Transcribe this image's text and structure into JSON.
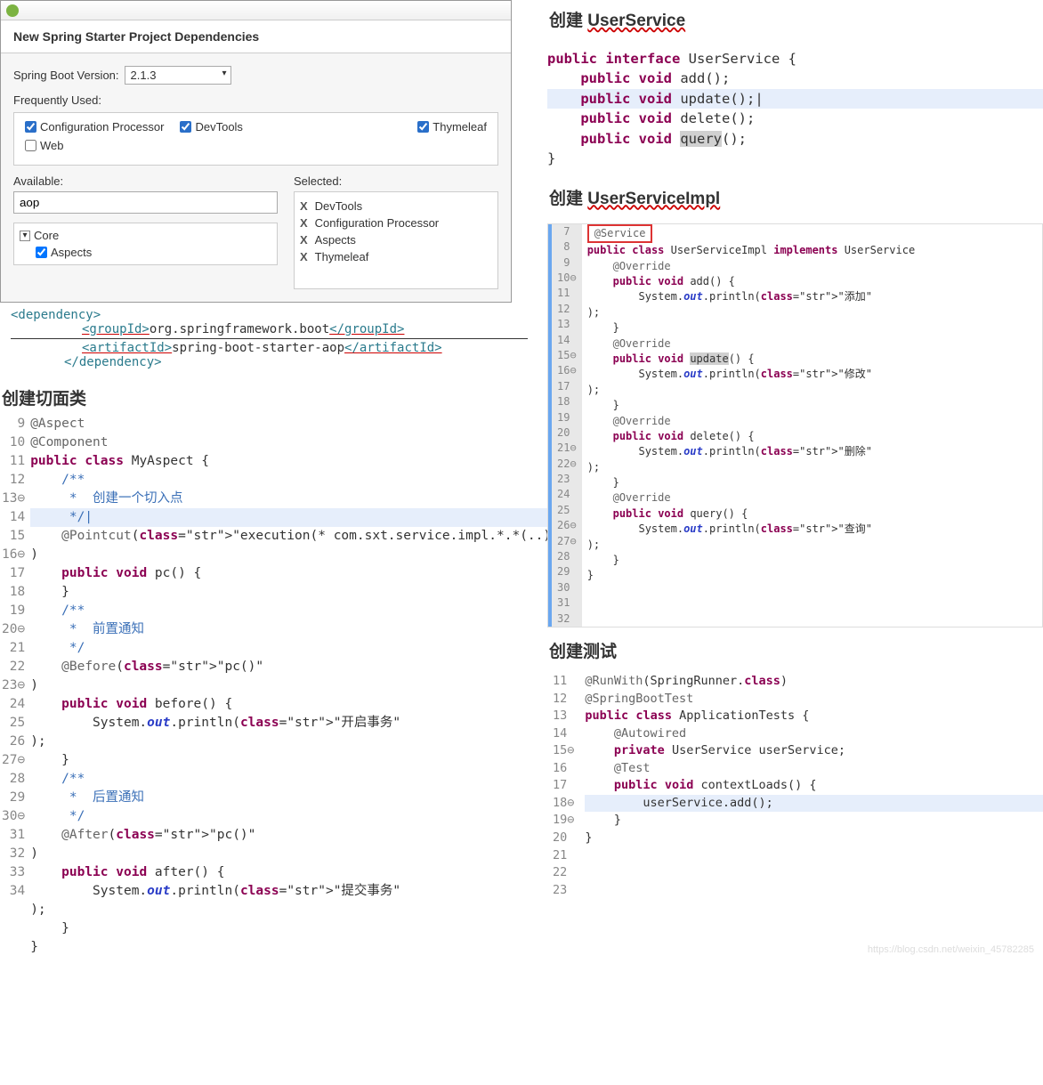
{
  "dialog": {
    "header": "New Spring Starter Project Dependencies",
    "bootVersionLabel": "Spring Boot Version:",
    "bootVersion": "2.1.3",
    "freqLabel": "Frequently Used:",
    "checks": [
      {
        "label": "Configuration Processor",
        "checked": true
      },
      {
        "label": "DevTools",
        "checked": true
      },
      {
        "label": "Thymeleaf",
        "checked": true
      },
      {
        "label": "Web",
        "checked": false
      }
    ],
    "availableLabel": "Available:",
    "availableValue": "aop",
    "treeParent": "Core",
    "treeChild": {
      "label": "Aspects",
      "checked": true
    },
    "selectedLabel": "Selected:",
    "selectedItems": [
      "DevTools",
      "Configuration Processor",
      "Aspects",
      "Thymeleaf"
    ]
  },
  "xml": {
    "openDep": "<dependency>",
    "groupOpen": "<groupId>",
    "groupText": "org.springframework.boot",
    "groupClose": "</groupId>",
    "artOpen": "<artifactId>",
    "artText": "spring-boot-starter-aop",
    "artClose": "</artifactId>",
    "closeDep": "</dependency>"
  },
  "leftTitle": "创建切面类",
  "aspectCode": {
    "lines": [
      {
        "n": "9",
        "m": " ",
        "t": "@Aspect"
      },
      {
        "n": "10",
        "m": " ",
        "t": "@Component"
      },
      {
        "n": "11",
        "m": " ",
        "t": "public class MyAspect {"
      },
      {
        "n": "12",
        "m": " ",
        "t": ""
      },
      {
        "n": "13",
        "m": "⊖",
        "t": "    /**"
      },
      {
        "n": "14",
        "m": " ",
        "t": "     *  创建一个切入点"
      },
      {
        "n": "15",
        "m": " ",
        "t": "     */|"
      },
      {
        "n": "16",
        "m": "⊖",
        "t": "    @Pointcut(\"execution(* com.sxt.service.impl.*.*(..))\")"
      },
      {
        "n": "17",
        "m": " ",
        "t": "    public void pc() {"
      },
      {
        "n": "18",
        "m": " ",
        "t": "    }"
      },
      {
        "n": "19",
        "m": " ",
        "t": ""
      },
      {
        "n": "20",
        "m": "⊖",
        "t": "    /**"
      },
      {
        "n": "21",
        "m": " ",
        "t": "     *  前置通知"
      },
      {
        "n": "22",
        "m": " ",
        "t": "     */"
      },
      {
        "n": "23",
        "m": "⊖",
        "t": "    @Before(\"pc()\")"
      },
      {
        "n": "24",
        "m": " ",
        "t": "    public void before() {"
      },
      {
        "n": "25",
        "m": " ",
        "t": "        System.out.println(\"开启事务\");"
      },
      {
        "n": "26",
        "m": " ",
        "t": "    }"
      },
      {
        "n": "27",
        "m": "⊖",
        "t": "    /**"
      },
      {
        "n": "28",
        "m": " ",
        "t": "     *  后置通知"
      },
      {
        "n": "29",
        "m": " ",
        "t": "     */"
      },
      {
        "n": "30",
        "m": "⊖",
        "t": "    @After(\"pc()\")"
      },
      {
        "n": "31",
        "m": " ",
        "t": "    public void after() {"
      },
      {
        "n": "32",
        "m": " ",
        "t": "        System.out.println(\"提交事务\");"
      },
      {
        "n": "33",
        "m": " ",
        "t": "    }"
      },
      {
        "n": "34",
        "m": " ",
        "t": "}"
      }
    ]
  },
  "right": {
    "title1": "创建 UserService",
    "ifaceCode": [
      "public interface UserService {",
      "",
      "    public void add();",
      "    public void update();|",
      "    public void delete();",
      "    public void query();",
      "}"
    ],
    "title2": "创建 UserServiceImpl",
    "implLines": [
      {
        "n": "7",
        "t": "@Service"
      },
      {
        "n": "8",
        "t": "public class UserServiceImpl implements UserService"
      },
      {
        "n": "9",
        "t": ""
      },
      {
        "n": "10",
        "t": "    @Override"
      },
      {
        "n": "11",
        "t": "    public void add() {"
      },
      {
        "n": "12",
        "t": "        System.out.println(\"添加\");"
      },
      {
        "n": "13",
        "t": "    }"
      },
      {
        "n": "14",
        "t": ""
      },
      {
        "n": "15",
        "t": "    @Override"
      },
      {
        "n": "16",
        "t": "    public void update() {"
      },
      {
        "n": "17",
        "t": "        System.out.println(\"修改\");"
      },
      {
        "n": "18",
        "t": ""
      },
      {
        "n": "19",
        "t": "    }"
      },
      {
        "n": "20",
        "t": ""
      },
      {
        "n": "21",
        "t": "    @Override"
      },
      {
        "n": "22",
        "t": "    public void delete() {"
      },
      {
        "n": "23",
        "t": "        System.out.println(\"删除\");"
      },
      {
        "n": "24",
        "t": ""
      },
      {
        "n": "25",
        "t": "    }"
      },
      {
        "n": "26",
        "t": "    @Override"
      },
      {
        "n": "27",
        "t": "    public void query() {"
      },
      {
        "n": "28",
        "t": "        System.out.println(\"查询\");"
      },
      {
        "n": "29",
        "t": ""
      },
      {
        "n": "30",
        "t": "    }"
      },
      {
        "n": "31",
        "t": "}"
      },
      {
        "n": "32",
        "t": ""
      }
    ],
    "title3": "创建测试",
    "testLines": [
      {
        "n": "11",
        "t": "@RunWith(SpringRunner.class)"
      },
      {
        "n": "12",
        "t": "@SpringBootTest"
      },
      {
        "n": "13",
        "t": "public class ApplicationTests {"
      },
      {
        "n": "14",
        "t": ""
      },
      {
        "n": "15",
        "t": "    @Autowired"
      },
      {
        "n": "16",
        "t": "    private UserService userService;"
      },
      {
        "n": "17",
        "t": ""
      },
      {
        "n": "18",
        "t": "    @Test"
      },
      {
        "n": "19",
        "t": "    public void contextLoads() {"
      },
      {
        "n": "20",
        "t": "        userService.add();"
      },
      {
        "n": "21",
        "t": "    }"
      },
      {
        "n": "22",
        "t": ""
      },
      {
        "n": "23",
        "t": "}"
      }
    ],
    "watermark": "https://blog.csdn.net/weixin_45782285"
  }
}
